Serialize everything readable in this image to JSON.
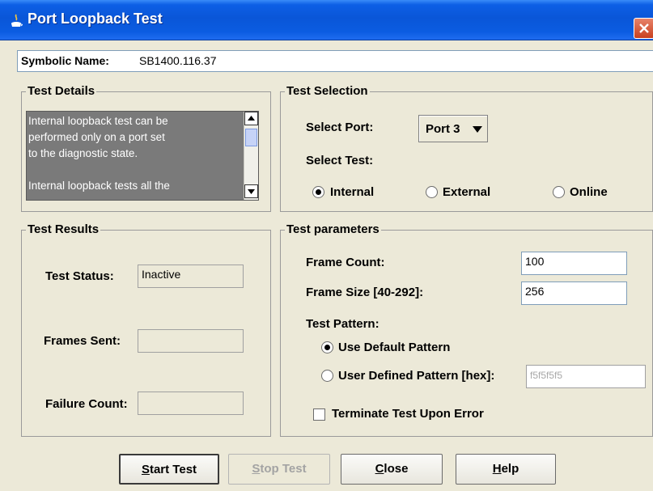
{
  "window": {
    "title": "Port Loopback Test"
  },
  "symbolic": {
    "label": "Symbolic Name:",
    "value": "SB1400.116.37"
  },
  "test_details": {
    "legend": "Test Details",
    "text": "Internal loopback test can be\nperformed only on a port set\nto the diagnostic state.\n\nInternal loopback tests all the"
  },
  "test_selection": {
    "legend": "Test Selection",
    "select_port_label": "Select Port:",
    "port_value": "Port 3",
    "select_test_label": "Select Test:",
    "options": [
      {
        "label": "Internal",
        "checked": true
      },
      {
        "label": "External",
        "checked": false
      },
      {
        "label": "Online",
        "checked": false
      }
    ]
  },
  "test_results": {
    "legend": "Test Results",
    "status_label": "Test Status:",
    "status_value": "Inactive",
    "frames_sent_label": "Frames Sent:",
    "frames_sent_value": "",
    "failure_count_label": "Failure Count:",
    "failure_count_value": ""
  },
  "test_parameters": {
    "legend": "Test parameters",
    "frame_count_label": "Frame Count:",
    "frame_count_value": "100",
    "frame_size_label": "Frame Size [40-292]:",
    "frame_size_value": "256",
    "pattern_label": "Test Pattern:",
    "default_pattern_label": "Use Default Pattern",
    "default_pattern_checked": true,
    "user_pattern_label": "User Defined Pattern [hex]:",
    "user_pattern_checked": false,
    "user_pattern_value": "f5f5f5f5",
    "terminate_label": "Terminate Test Upon Error",
    "terminate_checked": false
  },
  "buttons": {
    "start_prefix": "S",
    "start_rest": "tart Test",
    "stop_prefix": "S",
    "stop_rest": "top Test",
    "close_prefix": "C",
    "close_rest": "lose",
    "help_prefix": "H",
    "help_rest": "elp"
  },
  "colors": {
    "titlebar": "#0a56d8",
    "dialog_bg": "#ece9d8",
    "details_bg": "#7a7a7a"
  }
}
